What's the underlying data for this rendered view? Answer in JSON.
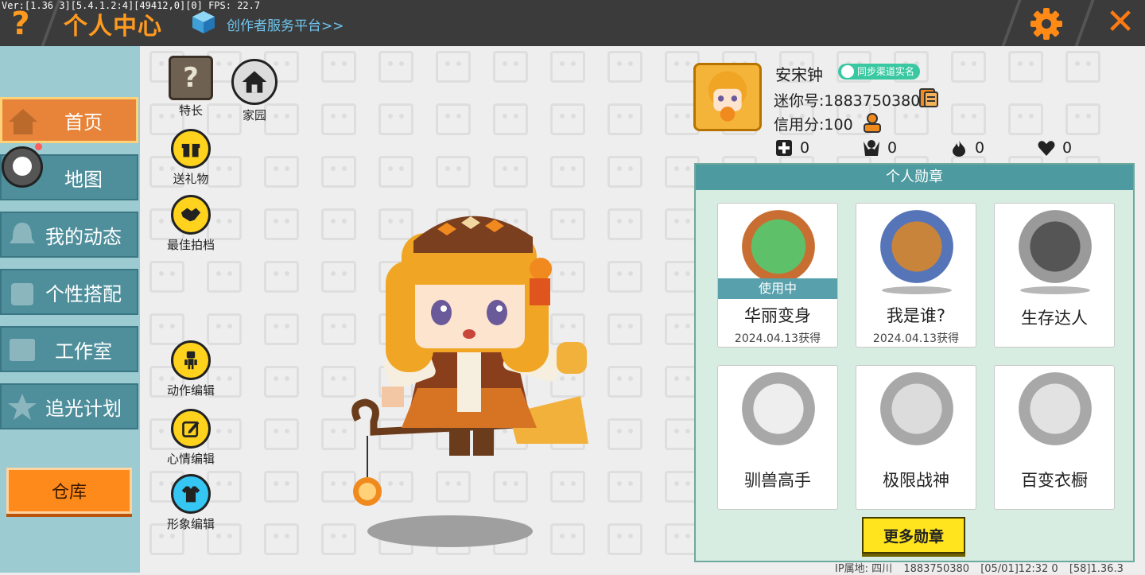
{
  "topbar": {
    "version": "Ver:[1.36.3][5.4.1.2:4][49412,0][0] FPS: 22.7",
    "help_glyph": "?",
    "title": "个人中心",
    "creator_link": "创作者服务平台>>",
    "close_glyph": "✕"
  },
  "nav": {
    "items": [
      {
        "label": "首页",
        "active": true
      },
      {
        "label": "地图",
        "active": false
      },
      {
        "label": "我的动态",
        "active": false
      },
      {
        "label": "个性搭配",
        "active": false
      },
      {
        "label": "工作室",
        "active": false
      },
      {
        "label": "追光计划",
        "active": false
      }
    ],
    "warehouse": "仓库"
  },
  "side_buttons": {
    "skill": "特长",
    "skill_glyph": "?",
    "home": "家园",
    "gift": "送礼物",
    "best_photo": "最佳拍档",
    "action_edit": "动作编辑",
    "mood_edit": "心情编辑",
    "look_edit": "形象编辑"
  },
  "profile": {
    "username": "安宋钟",
    "realname_badge": "同步渠道实名",
    "mini_id": "迷你号:1883750380",
    "credit": "信用分:100",
    "stats": {
      "add": "0",
      "fans": "0",
      "hot": "0",
      "likes": "0"
    }
  },
  "medals": {
    "header": "个人勋章",
    "in_use_label": "使用中",
    "items": [
      {
        "name": "华丽变身",
        "date": "2024.04.13获得",
        "in_use": true,
        "color": "#d97d3a"
      },
      {
        "name": "我是谁?",
        "date": "2024.04.13获得",
        "in_use": false,
        "color": "#5575b8"
      },
      {
        "name": "生存达人",
        "date": "",
        "in_use": false,
        "color": "#9a9a9a"
      },
      {
        "name": "驯兽高手",
        "date": "",
        "in_use": false,
        "color": "#a8a8a8"
      },
      {
        "name": "极限战神",
        "date": "",
        "in_use": false,
        "color": "#a8a8a8"
      },
      {
        "name": "百变衣橱",
        "date": "",
        "in_use": false,
        "color": "#a8a8a8"
      }
    ],
    "more": "更多勋章"
  },
  "footer": {
    "ip": "IP属地: 四川",
    "uid": "1883750380",
    "time": "[05/01]12:32 0",
    "build": "[58]1.36.3"
  },
  "colors": {
    "accent": "#ff9a1f",
    "nav": "#4f8f9c",
    "nav_active": "#e7843a",
    "panel_header": "#4d9aa0"
  }
}
